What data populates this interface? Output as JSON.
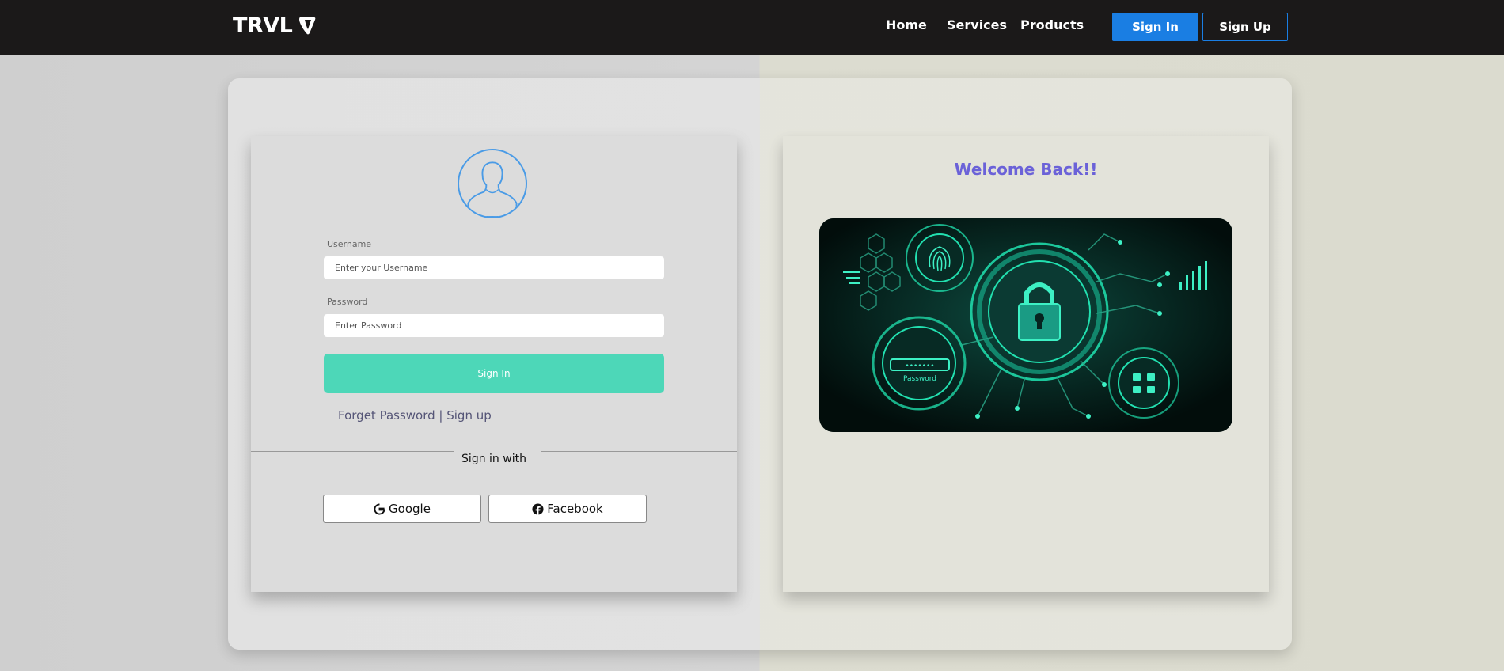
{
  "nav": {
    "logo": "TRVL",
    "links": [
      "Home",
      "Services",
      "Products"
    ],
    "signin": "Sign In",
    "signup": "Sign Up"
  },
  "login": {
    "username_label": "Username",
    "username_placeholder": "Enter your Username",
    "password_label": "Password",
    "password_placeholder": "Enter Password",
    "signin_button": "Sign In",
    "forget_password": "Forget Password",
    "separator": " | ",
    "signup_link": "Sign up",
    "signin_with": "Sign in with",
    "google": "Google",
    "facebook": "Facebook"
  },
  "welcome": {
    "title": "Welcome Back!!",
    "image_caption": "Password"
  },
  "colors": {
    "navbar": "#1b1919",
    "primary_blue": "#1a7ee3",
    "signin_teal": "#4dd7b8",
    "welcome_purple": "#6b62d8"
  }
}
